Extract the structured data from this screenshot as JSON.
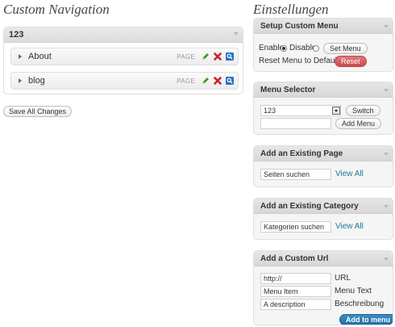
{
  "left": {
    "title": "Custom Navigation",
    "menu_name": "123",
    "items": [
      {
        "label": "About",
        "type": "PAGE"
      },
      {
        "label": "blog",
        "type": "PAGE"
      }
    ],
    "save_label": "Save All Changes"
  },
  "right": {
    "title": "Einstellungen",
    "setup": {
      "header": "Setup Custom Menu",
      "enable_label": "Enable",
      "disable_label": "Disable",
      "set_menu_label": "Set Menu",
      "reset_text": "Reset Menu to Default",
      "reset_label": "Reset"
    },
    "selector": {
      "header": "Menu Selector",
      "selected": "123",
      "switch_label": "Switch",
      "new_menu_value": "",
      "add_menu_label": "Add Menu"
    },
    "existing_page": {
      "header": "Add an Existing Page",
      "search_value": "Seiten suchen",
      "view_all": "View All"
    },
    "existing_category": {
      "header": "Add an Existing Category",
      "search_value": "Kategorien suchen",
      "view_all": "View All"
    },
    "custom_url": {
      "header": "Add a Custom Url",
      "url_value": "http://",
      "url_label": "URL",
      "text_value": "Menu Item",
      "text_label": "Menu Text",
      "desc_value": "A description",
      "desc_label": "Beschreibung",
      "add_label": "Add to menu"
    }
  },
  "colors": {
    "link": "#21759b",
    "reset": "#c94a4a",
    "add_to_menu": "#1f6ea6",
    "edit_icon": "#3a9a2a",
    "delete_icon": "#cc2222",
    "view_icon": "#2a72c8"
  },
  "icons": [
    "expand-arrow-icon",
    "edit-pencil-icon",
    "delete-x-icon",
    "view-magnifier-icon",
    "collapse-toggle-icon",
    "dropdown-arrow-icon"
  ]
}
